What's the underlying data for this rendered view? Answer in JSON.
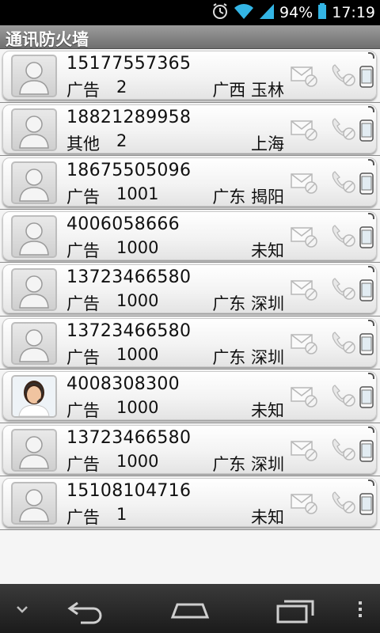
{
  "status_bar": {
    "battery_percent": "94%",
    "time": "17:19",
    "icons": [
      "alarm-icon",
      "wifi-icon",
      "signal-icon",
      "battery-icon"
    ]
  },
  "app": {
    "title": "通讯防火墙"
  },
  "entries": [
    {
      "number": "15177557365",
      "category": "广告",
      "count": "2",
      "location": "广西 玉林",
      "avatar": "default"
    },
    {
      "number": "18821289958",
      "category": "其他",
      "count": "2",
      "location": "上海",
      "avatar": "default"
    },
    {
      "number": "18675505096",
      "category": "广告",
      "count": "1001",
      "location": "广东 揭阳",
      "avatar": "default"
    },
    {
      "number": "4006058666",
      "category": "广告",
      "count": "1000",
      "location": "未知",
      "avatar": "default"
    },
    {
      "number": "13723466580",
      "category": "广告",
      "count": "1000",
      "location": "广东 深圳",
      "avatar": "default"
    },
    {
      "number": "13723466580",
      "category": "广告",
      "count": "1000",
      "location": "广东 深圳",
      "avatar": "default"
    },
    {
      "number": "4008308300",
      "category": "广告",
      "count": "1000",
      "location": "未知",
      "avatar": "service-agent"
    },
    {
      "number": "13723466580",
      "category": "广告",
      "count": "1000",
      "location": "广东 深圳",
      "avatar": "default"
    },
    {
      "number": "15108104716",
      "category": "广告",
      "count": "1",
      "location": "未知",
      "avatar": "default"
    }
  ],
  "row_icons": [
    "sms-block-icon",
    "call-block-icon",
    "mobile-phone-icon"
  ],
  "nav_bar": [
    "chevron-down-icon",
    "back-icon",
    "home-icon",
    "recent-apps-icon",
    "overflow-menu-icon"
  ],
  "colors": {
    "status_bar": "#000000",
    "title_bar": "#8a8a8a",
    "wifi": "#33b5e5",
    "nav_bar": "#2a2a2a"
  }
}
